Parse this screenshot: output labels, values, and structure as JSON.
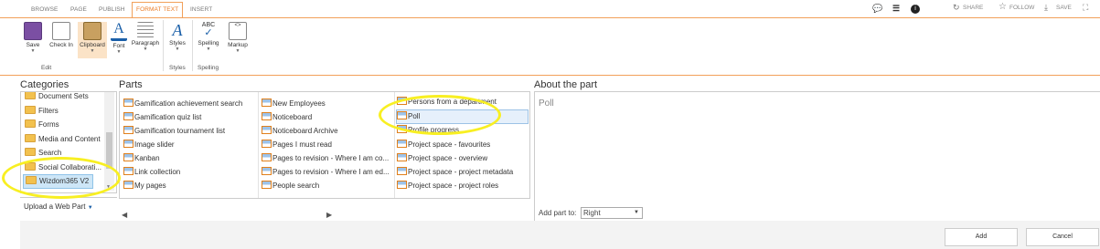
{
  "tabs": [
    "BROWSE",
    "PAGE",
    "PUBLISH",
    "FORMAT TEXT",
    "INSERT"
  ],
  "actions": {
    "share": "SHARE",
    "follow": "FOLLOW",
    "save": "SAVE"
  },
  "ribbon": {
    "save": "Save",
    "checkin": "Check In",
    "clipboard": "Clipboard",
    "font": "Font",
    "paragraph": "Paragraph",
    "styles": "Styles",
    "spelling": "Spelling",
    "markup": "Markup",
    "groups": {
      "edit": "Edit",
      "styles": "Styles",
      "spelling": "Spelling"
    },
    "abc": "ABC"
  },
  "categories": {
    "title": "Categories",
    "items": [
      "Document Sets",
      "Filters",
      "Forms",
      "Media and Content",
      "Search",
      "Social Collaborati...",
      "Wizdom365 V2"
    ],
    "upload": "Upload a Web Part"
  },
  "parts": {
    "title": "Parts",
    "col1": [
      "Gamification achievement search",
      "Gamification quiz list",
      "Gamification tournament list",
      "Image slider",
      "Kanban",
      "Link collection",
      "My pages"
    ],
    "col2": [
      "New Employees",
      "Noticeboard",
      "Noticeboard Archive",
      "Pages I must read",
      "Pages to revision - Where I am co...",
      "Pages to revision - Where I am ed...",
      "People search"
    ],
    "col3": [
      "Persons from a department",
      "Poll",
      "Profile progress",
      "Project space - favourites",
      "Project space - overview",
      "Project space - project metadata",
      "Project space - project roles"
    ]
  },
  "about": {
    "title": "About the part",
    "name": "Poll",
    "addto_label": "Add part to:",
    "addto_value": "Right"
  },
  "buttons": {
    "add": "Add",
    "cancel": "Cancel"
  }
}
